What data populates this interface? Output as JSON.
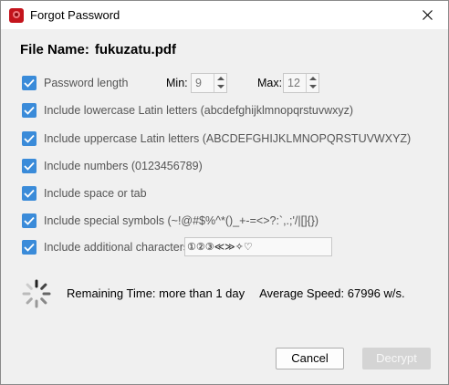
{
  "window": {
    "title": "Forgot Password"
  },
  "file": {
    "label": "File Name:",
    "name": "fukuzatu.pdf"
  },
  "options": {
    "password_length": {
      "label": "Password length",
      "checked": true
    },
    "min_label": "Min:",
    "min_value": "9",
    "max_label": "Max:",
    "max_value": "12",
    "lowercase": {
      "label": "Include lowercase Latin letters (abcdefghijklmnopqrstuvwxyz)",
      "checked": true
    },
    "uppercase": {
      "label": "Include uppercase Latin letters (ABCDEFGHIJKLMNOPQRSTUVWXYZ)",
      "checked": true
    },
    "numbers": {
      "label": "Include numbers (0123456789)",
      "checked": true
    },
    "space": {
      "label": "Include space or tab",
      "checked": true
    },
    "special": {
      "label": "Include special symbols (~!@#$%^*()_+-=<>?:`,.;'/|[]{})",
      "checked": true
    },
    "additional": {
      "label": "Include additional characters",
      "checked": true,
      "value": "①②③≪≫✧♡"
    }
  },
  "status": {
    "remaining_label": "Remaining Time:",
    "remaining_value": "more than 1 day",
    "speed_label": "Average Speed:",
    "speed_value": "67996 w/s."
  },
  "buttons": {
    "cancel": "Cancel",
    "decrypt": "Decrypt"
  },
  "colors": {
    "checkbox": "#3a8bd9",
    "disabled_button": "#d4d4d4"
  }
}
